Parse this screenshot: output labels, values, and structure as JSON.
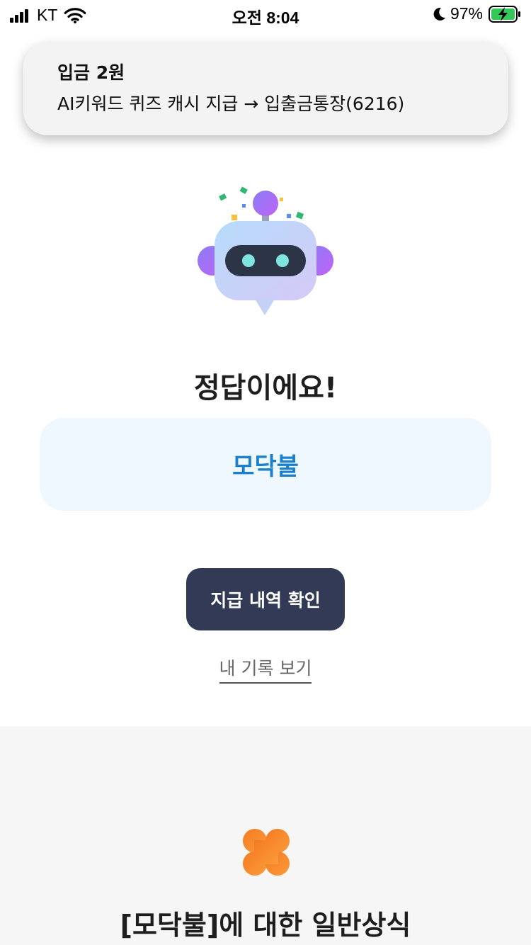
{
  "status_bar": {
    "carrier": "KT",
    "time": "오전 8:04",
    "battery_percent": "97%",
    "icons": [
      "signal-icon",
      "wifi-icon",
      "moon-icon",
      "battery-charging-icon"
    ]
  },
  "notification": {
    "title": "입금 2원",
    "body": "AI키워드 퀴즈 캐시 지급 → 입출금통장(6216)"
  },
  "result": {
    "title": "정답이에요!",
    "answer": "모닥불",
    "primary_button": "지급 내역 확인",
    "link": "내 기록 보기"
  },
  "knowledge": {
    "icon": "clover-icon",
    "title": "[모닥불]에 대한 일반상식"
  },
  "colors": {
    "answer_text": "#1a7fcc",
    "answer_box": "#f0f8ff",
    "primary_button": "#333a56",
    "clover": "#f58a2c",
    "section_bg": "#f6f6f6"
  }
}
